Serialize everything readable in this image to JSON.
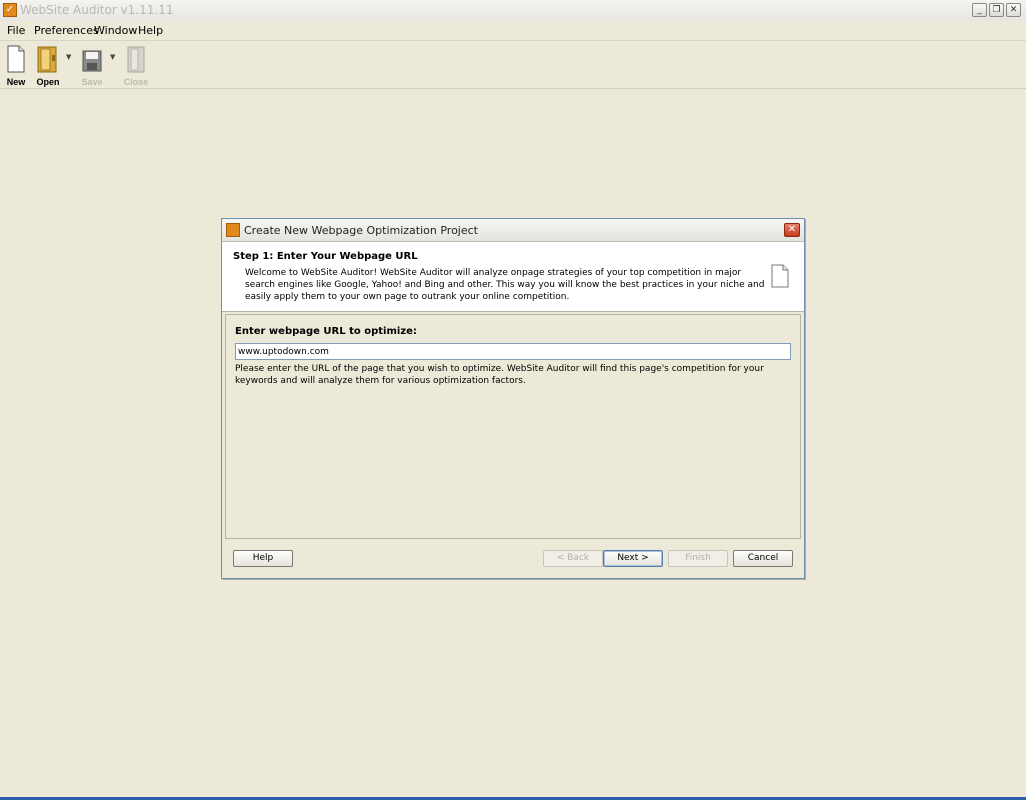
{
  "window": {
    "title": "WebSite Auditor v1.11.11"
  },
  "menu": [
    "File",
    "Preferences",
    "Window",
    "Help"
  ],
  "toolbar": {
    "new": "New",
    "open": "Open",
    "save": "Save",
    "close": "Close"
  },
  "dialog": {
    "title": "Create New Webpage Optimization Project",
    "step_title": "Step 1: Enter Your Webpage URL",
    "step_description": "Welcome to WebSite Auditor! WebSite Auditor will analyze onpage strategies of your top competition in major search engines like Google, Yahoo! and Bing and other. This way you will know the best practices in your niche and easily apply them to your own page to outrank your online competition.",
    "url_label": "Enter webpage URL to optimize:",
    "url_value": "www.uptodown.com",
    "url_help": "Please enter the URL of the page that you wish to optimize. WebSite Auditor will find this page's competition for your keywords and will analyze them for various optimization factors.",
    "buttons": {
      "help": "Help",
      "back": "< Back",
      "next": "Next >",
      "finish": "Finish",
      "cancel": "Cancel"
    }
  }
}
